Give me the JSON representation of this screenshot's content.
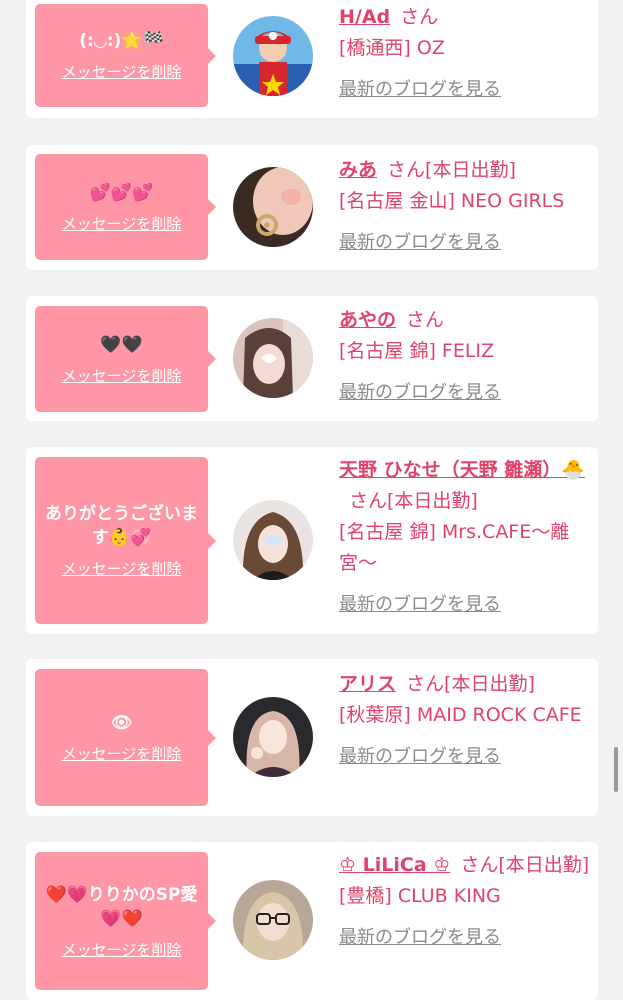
{
  "cards": [
    {
      "message": "(:◡:)🌟🏁",
      "delete_label": "メッセージを削除",
      "name": "H/Ad",
      "honorific": "さん",
      "status": "",
      "shop": "[橋通西] OZ",
      "blog_link": "最新のブログを見る"
    },
    {
      "message": "💕💕💕",
      "delete_label": "メッセージを削除",
      "name": "みあ",
      "honorific": "さん",
      "status": "[本日出勤]",
      "shop": "[名古屋 金山] NEO GIRLS",
      "blog_link": "最新のブログを見る"
    },
    {
      "message": "🖤🖤",
      "delete_label": "メッセージを削除",
      "name": "あやの",
      "honorific": "さん",
      "status": "",
      "shop": "[名古屋 錦] FELIZ",
      "blog_link": "最新のブログを見る"
    },
    {
      "message": "ありがとうございます👶💞",
      "delete_label": "メッセージを削除",
      "name": "天野 ひなせ（天野 雛瀬）🐣",
      "honorific": "さん",
      "status": "[本日出勤]",
      "shop": "[名古屋 錦] Mrs.CAFE〜離宮〜",
      "blog_link": "最新のブログを見る"
    },
    {
      "message": "👁",
      "delete_label": "メッセージを削除",
      "name": "アリス",
      "honorific": "さん",
      "status": "[本日出勤]",
      "shop": "[秋葉原] MAID ROCK CAFE",
      "blog_link": "最新のブログを見る"
    },
    {
      "message": "❤️💗りりかのSP愛💗❤️",
      "delete_label": "メッセージを削除",
      "name": "♔ LiLiCa ♔",
      "honorific": "さん",
      "status": "[本日出勤]",
      "shop": "[豊橋] CLUB KING",
      "blog_link": "最新のブログを見る"
    }
  ],
  "avatars": [
    "avatar-mario-costume",
    "avatar-earring-closeup",
    "avatar-blurred-face",
    "avatar-hair-blurred",
    "avatar-cafe-girl",
    "avatar-glasses-girl"
  ],
  "colors": {
    "accent": "#e0426a",
    "bubble": "#ff96a6",
    "background": "#f2f2f2"
  }
}
